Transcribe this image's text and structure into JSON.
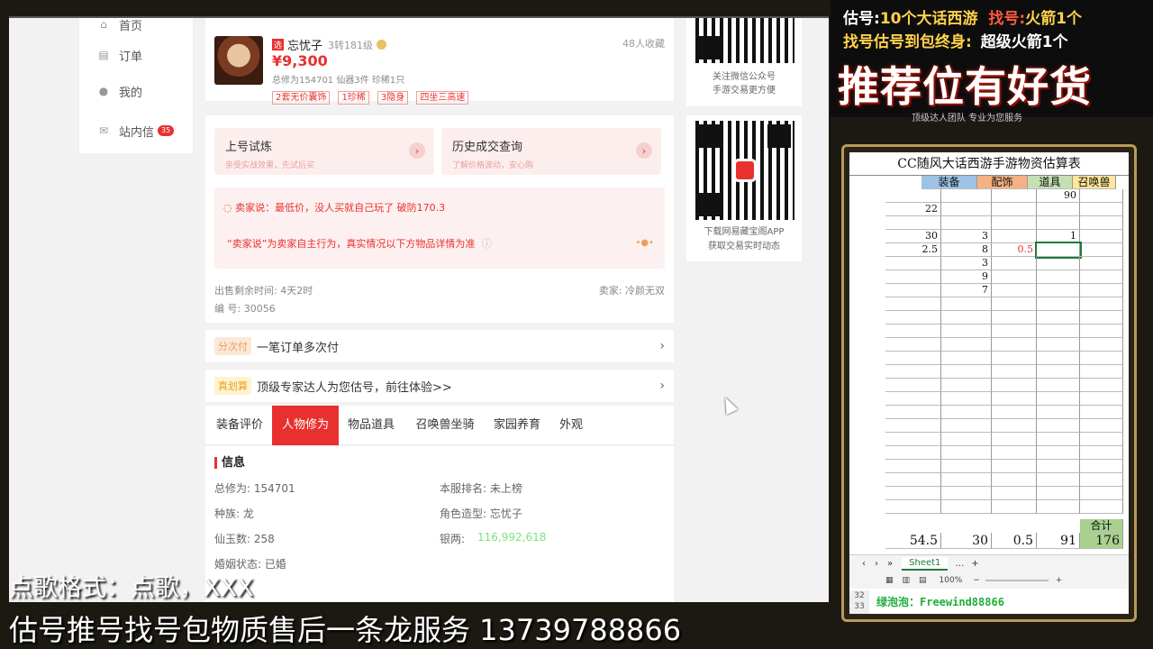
{
  "nav": {
    "items": [
      {
        "label": "首页",
        "icon": "home-icon"
      },
      {
        "label": "订单",
        "icon": "order-icon"
      },
      {
        "label": "我的",
        "icon": "user-icon"
      },
      {
        "label": "站内信",
        "icon": "mail-icon",
        "badge": "35"
      }
    ]
  },
  "product": {
    "server_tag": "选",
    "name": "忘忧子",
    "level": "3转181级",
    "favorites": "48人收藏",
    "price": "¥9,300",
    "stats": "总修为154701  仙器3件  珍稀1只",
    "tags": [
      "2套无价囊饰",
      "1珍稀",
      "3隐身",
      "四坐三高速"
    ]
  },
  "actions": {
    "trial": {
      "title": "上号试炼",
      "sub": "亲受实战效果，先试后买"
    },
    "history": {
      "title": "历史成交查询",
      "sub": "了解价格波动，安心购"
    }
  },
  "seller_note": {
    "line1": "卖家说：最低价，没人买就自己玩了 破防170.3",
    "line2": "“卖家说”为卖家自主行为，真实情况以下方物品详情为准"
  },
  "listing": {
    "time_left": "出售剩余时间: 4天2时",
    "seller": "卖家: 冷颜无双",
    "code": "编 号: 30056"
  },
  "installments": {
    "pill": "分次付",
    "text": "一笔订单多次付"
  },
  "valuation": {
    "pill": "真划算",
    "text": "顶级专家达人为您估号，前往体验>>"
  },
  "tabs": [
    "装备评价",
    "人物修为",
    "物品道具",
    "召唤兽坐骑",
    "家园养育",
    "外观"
  ],
  "info": {
    "heading": "信息",
    "left": [
      "总修为: 154701",
      "种族: 龙",
      "仙玉数: 258",
      "婚姻状态: 已婚"
    ],
    "right_labels": [
      "本服排名: 未上榜",
      "角色造型: 忘忧子",
      "银两:"
    ],
    "silver": "116,992,618"
  },
  "qr": [
    {
      "label1": "关注微信公众号",
      "label2": "手游交易更方便"
    },
    {
      "label1": "下载网易藏宝阁APP",
      "label2": "获取交易实时动态"
    }
  ],
  "promo": {
    "line1_a": "估号:",
    "line1_b": "10个大话西游",
    "line1_c": "找号:",
    "line1_d": "火箭1个",
    "line2_a": "找号估号到包终身:",
    "line2_b": "超级火箭1个",
    "big": "推荐位有好货",
    "sub": "顶级达人团队 专业为您服务"
  },
  "sheet": {
    "title": "CC随风大话西游手游物资估算表",
    "headers": [
      "装备",
      "配饰",
      "道具",
      "召唤兽"
    ],
    "rows": [
      [
        "",
        "",
        "",
        "90"
      ],
      [
        "22",
        "",
        "",
        ""
      ],
      [
        "",
        "",
        "",
        ""
      ],
      [
        "30",
        "3",
        "",
        "1"
      ],
      [
        "2.5",
        "8",
        "0.5",
        ""
      ],
      [
        "",
        "3",
        "",
        ""
      ],
      [
        "",
        "9",
        "",
        ""
      ],
      [
        "",
        "7",
        "",
        ""
      ]
    ],
    "total_label": "合计",
    "totals": [
      "54.5",
      "30",
      "0.5",
      "91",
      "176"
    ],
    "sheet_tab": "Sheet1",
    "zoom": "100%",
    "row32": "32",
    "row33": "33",
    "wechat": "绿泡泡：Freewind88866"
  },
  "overlay": {
    "song": "点歌格式：点歌，XXX",
    "service": "估号推号找号包物质售后一条龙服务 13739788866"
  }
}
